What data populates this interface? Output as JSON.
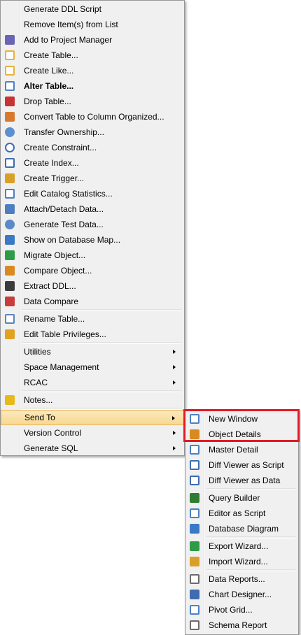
{
  "main_menu": {
    "group1": [
      {
        "label": "Generate DDL Script",
        "icon": "none"
      },
      {
        "label": "Remove Item(s) from List",
        "icon": "none"
      },
      {
        "label": "Add to Project Manager",
        "icon": "project-manager-icon",
        "color": "#6a64b4"
      },
      {
        "label": "Create Table...",
        "icon": "create-table-icon",
        "color": "#e8b23a"
      },
      {
        "label": "Create Like...",
        "icon": "create-like-icon",
        "color": "#e8b23a"
      },
      {
        "label": "Alter Table...",
        "icon": "alter-table-icon",
        "color": "#4b82c3",
        "bold": true
      },
      {
        "label": "Drop Table...",
        "icon": "drop-table-icon",
        "color": "#c83232"
      },
      {
        "label": "Convert Table to Column Organized...",
        "icon": "convert-table-icon",
        "color": "#d77a2f"
      },
      {
        "label": "Transfer Ownership...",
        "icon": "transfer-ownership-icon",
        "color": "#5b8fcf"
      },
      {
        "label": "Create Constraint...",
        "icon": "create-constraint-icon",
        "color": "#3f6cb0"
      },
      {
        "label": "Create Index...",
        "icon": "create-index-icon",
        "color": "#3f6cb0"
      },
      {
        "label": "Create Trigger...",
        "icon": "create-trigger-icon",
        "color": "#d9a028"
      },
      {
        "label": "Edit Catalog Statistics...",
        "icon": "catalog-statistics-icon",
        "color": "#4d7fc0"
      },
      {
        "label": "Attach/Detach Data...",
        "icon": "attach-detach-icon",
        "color": "#4d7fc0"
      },
      {
        "label": "Generate Test Data...",
        "icon": "generate-test-data-icon",
        "color": "#5a8acb"
      },
      {
        "label": "Show on Database Map...",
        "icon": "database-map-icon",
        "color": "#3a79c5"
      },
      {
        "label": "Migrate Object...",
        "icon": "migrate-object-icon",
        "color": "#2e9b47"
      },
      {
        "label": "Compare Object...",
        "icon": "compare-object-icon",
        "color": "#d98a1e"
      },
      {
        "label": "Extract DDL...",
        "icon": "extract-ddl-icon",
        "color": "#3b3b3b"
      },
      {
        "label": "Data Compare",
        "icon": "data-compare-icon",
        "color": "#c83c3c"
      }
    ],
    "group2": [
      {
        "label": "Rename Table...",
        "icon": "rename-table-icon",
        "color": "#5b82bf"
      },
      {
        "label": "Edit Table Privileges...",
        "icon": "table-privileges-icon",
        "color": "#e0a21f"
      }
    ],
    "group3": [
      {
        "label": "Utilities",
        "submenu": true
      },
      {
        "label": "Space Management",
        "submenu": true
      },
      {
        "label": "RCAC",
        "submenu": true
      }
    ],
    "group4": [
      {
        "label": "Notes...",
        "icon": "notes-icon",
        "color": "#e8b91a"
      }
    ],
    "group5": [
      {
        "label": "Send To",
        "submenu": true,
        "highlighted": true
      },
      {
        "label": "Version Control",
        "submenu": true
      },
      {
        "label": "Generate SQL",
        "submenu": true
      }
    ]
  },
  "send_to_menu": {
    "group1": [
      {
        "label": "New Window",
        "icon": "new-window-icon",
        "color": "#4b82c3"
      },
      {
        "label": "Object Details",
        "icon": "object-details-icon",
        "color": "#d98a1e"
      },
      {
        "label": "Master Detail",
        "icon": "master-detail-icon",
        "color": "#4b82c3"
      },
      {
        "label": "Diff Viewer as Script",
        "icon": "diff-viewer-script-icon",
        "color": "#3f6cb0"
      },
      {
        "label": "Diff Viewer as Data",
        "icon": "diff-viewer-data-icon",
        "color": "#3f6cb0"
      }
    ],
    "group2": [
      {
        "label": "Query Builder",
        "icon": "query-builder-icon",
        "color": "#2e7d32"
      },
      {
        "label": "Editor as Script",
        "icon": "editor-script-icon",
        "color": "#4b82c3"
      },
      {
        "label": "Database Diagram",
        "icon": "database-diagram-icon",
        "color": "#3a79c5"
      }
    ],
    "group3": [
      {
        "label": "Export Wizard...",
        "icon": "export-wizard-icon",
        "color": "#2e9b47"
      },
      {
        "label": "Import Wizard...",
        "icon": "import-wizard-icon",
        "color": "#d9a028"
      }
    ],
    "group4": [
      {
        "label": "Data Reports...",
        "icon": "data-reports-icon",
        "color": "#6b6b6b"
      },
      {
        "label": "Chart Designer...",
        "icon": "chart-designer-icon",
        "color": "#3f6cb0"
      },
      {
        "label": "Pivot Grid...",
        "icon": "pivot-grid-icon",
        "color": "#4b82c3"
      },
      {
        "label": "Schema Report",
        "icon": "schema-report-icon",
        "color": "#6b6b6b"
      }
    ]
  },
  "annotation": {
    "color": "#e21b25"
  }
}
